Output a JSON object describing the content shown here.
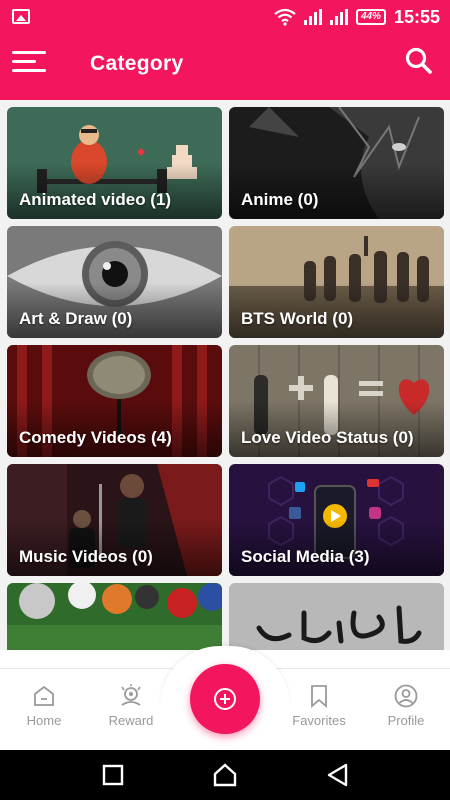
{
  "status_bar": {
    "time": "15:55",
    "battery": "44%",
    "icons": [
      "gallery-icon",
      "wifi-icon",
      "signal-icon",
      "signal-icon",
      "battery-icon"
    ]
  },
  "header": {
    "title": "Category",
    "menu_icon": "menu-icon",
    "search_icon": "search-icon"
  },
  "categories": [
    {
      "label": "Animated video (1)"
    },
    {
      "label": "Anime (0)"
    },
    {
      "label": "Art & Draw (0)"
    },
    {
      "label": "BTS World (0)"
    },
    {
      "label": "Comedy Videos (4)"
    },
    {
      "label": "Love Video Status (0)"
    },
    {
      "label": "Music Videos (0)"
    },
    {
      "label": "Social Media  (3)"
    }
  ],
  "bottom_nav": {
    "home": "Home",
    "reward": "Reward",
    "favorites": "Favorites",
    "profile": "Profile",
    "fab_icon": "plus-circle-icon"
  },
  "colors": {
    "accent": "#f3165c",
    "nav_text": "#9a9a9a"
  }
}
